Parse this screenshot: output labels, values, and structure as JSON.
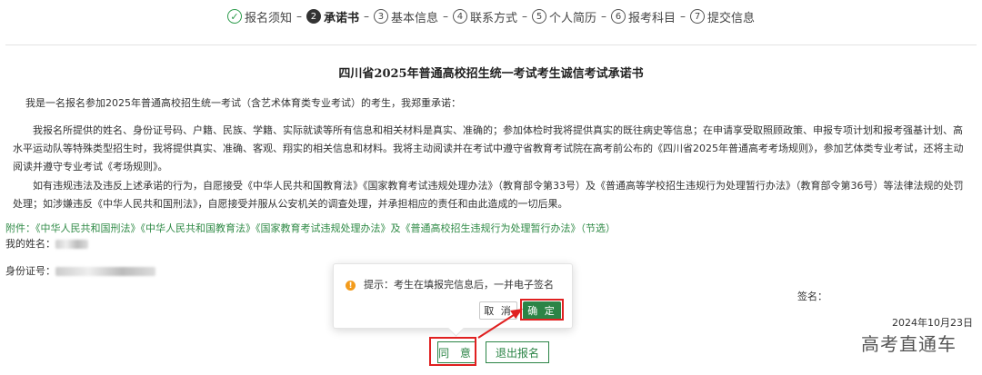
{
  "steps": [
    {
      "num": "✓",
      "label": "报名须知",
      "state": "done"
    },
    {
      "num": "2",
      "label": "承诺书",
      "state": "active"
    },
    {
      "num": "3",
      "label": "基本信息",
      "state": "todo"
    },
    {
      "num": "4",
      "label": "联系方式",
      "state": "todo"
    },
    {
      "num": "5",
      "label": "个人简历",
      "state": "todo"
    },
    {
      "num": "6",
      "label": "报考科目",
      "state": "todo"
    },
    {
      "num": "7",
      "label": "提交信息",
      "state": "todo"
    }
  ],
  "step_separator": "–",
  "title": "四川省2025年普通高校招生统一考试考生诚信考试承诺书",
  "paragraphs": {
    "p1": "我是一名报名参加2025年普通高校招生统一考试（含艺术体育类专业考试）的考生，我郑重承诺：",
    "p2": "我报名所提供的姓名、身份证号码、户籍、民族、学籍、实际就读等所有信息和相关材料是真实、准确的；参加体检时我将提供真实的既往病史等信息；在申请享受取照顾政策、申报专项计划和报考强基计划、高水平运动队等特殊类型招生时，我将提供真实、准确、客观、翔实的相关信息和材料。我将主动阅读并在考试中遵守省教育考试院在高考前公布的《四川省2025年普通高考考场规则》，参加艺体类专业考试，还将主动阅读并遵守专业考试《考场规则》。",
    "p3": "如有违规违法及违反上述承诺的行为，自愿接受《中华人民共和国教育法》《国家教育考试违规处理办法》（教育部令第33号）及《普通高等学校招生违规行为处理暂行办法》（教育部令第36号）等法律法规的处罚处理；如涉嫌违反《中华人民共和国刑法》，自愿接受并服从公安机关的调查处理，并承担相应的责任和由此造成的一切后果。"
  },
  "attachment": "附件：《中华人民共和国刑法》《中华人民共和国教育法》《国家教育考试违规处理办法》及《普通高校招生违规行为处理暂行办法》（节选）",
  "name_label": "我的姓名：",
  "id_label": "身份证号：",
  "id_partial_visible": "...",
  "sign_label": "签名：",
  "date": "2024年10月23日",
  "popover": {
    "icon": "warning-icon",
    "text": "提示：考生在填报完信息后，一并电子签名",
    "cancel": "取 消",
    "confirm": "确 定"
  },
  "buttons": {
    "agree": "同 意",
    "exit": "退出报名"
  },
  "watermark": "高考直通车",
  "colors": {
    "brand_green": "#2b8446",
    "annotation_red": "#e02020",
    "warning_orange": "#f39b1b"
  }
}
